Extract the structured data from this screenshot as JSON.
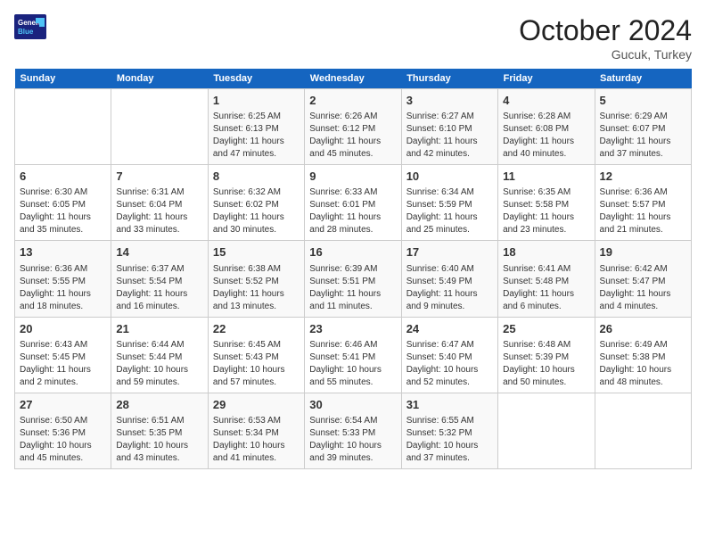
{
  "header": {
    "logo_general": "General",
    "logo_blue": "Blue",
    "month_title": "October 2024",
    "location": "Gucuk, Turkey"
  },
  "weekdays": [
    "Sunday",
    "Monday",
    "Tuesday",
    "Wednesday",
    "Thursday",
    "Friday",
    "Saturday"
  ],
  "weeks": [
    [
      {
        "day": "",
        "info": ""
      },
      {
        "day": "",
        "info": ""
      },
      {
        "day": "1",
        "info": "Sunrise: 6:25 AM\nSunset: 6:13 PM\nDaylight: 11 hours and 47 minutes."
      },
      {
        "day": "2",
        "info": "Sunrise: 6:26 AM\nSunset: 6:12 PM\nDaylight: 11 hours and 45 minutes."
      },
      {
        "day": "3",
        "info": "Sunrise: 6:27 AM\nSunset: 6:10 PM\nDaylight: 11 hours and 42 minutes."
      },
      {
        "day": "4",
        "info": "Sunrise: 6:28 AM\nSunset: 6:08 PM\nDaylight: 11 hours and 40 minutes."
      },
      {
        "day": "5",
        "info": "Sunrise: 6:29 AM\nSunset: 6:07 PM\nDaylight: 11 hours and 37 minutes."
      }
    ],
    [
      {
        "day": "6",
        "info": "Sunrise: 6:30 AM\nSunset: 6:05 PM\nDaylight: 11 hours and 35 minutes."
      },
      {
        "day": "7",
        "info": "Sunrise: 6:31 AM\nSunset: 6:04 PM\nDaylight: 11 hours and 33 minutes."
      },
      {
        "day": "8",
        "info": "Sunrise: 6:32 AM\nSunset: 6:02 PM\nDaylight: 11 hours and 30 minutes."
      },
      {
        "day": "9",
        "info": "Sunrise: 6:33 AM\nSunset: 6:01 PM\nDaylight: 11 hours and 28 minutes."
      },
      {
        "day": "10",
        "info": "Sunrise: 6:34 AM\nSunset: 5:59 PM\nDaylight: 11 hours and 25 minutes."
      },
      {
        "day": "11",
        "info": "Sunrise: 6:35 AM\nSunset: 5:58 PM\nDaylight: 11 hours and 23 minutes."
      },
      {
        "day": "12",
        "info": "Sunrise: 6:36 AM\nSunset: 5:57 PM\nDaylight: 11 hours and 21 minutes."
      }
    ],
    [
      {
        "day": "13",
        "info": "Sunrise: 6:36 AM\nSunset: 5:55 PM\nDaylight: 11 hours and 18 minutes."
      },
      {
        "day": "14",
        "info": "Sunrise: 6:37 AM\nSunset: 5:54 PM\nDaylight: 11 hours and 16 minutes."
      },
      {
        "day": "15",
        "info": "Sunrise: 6:38 AM\nSunset: 5:52 PM\nDaylight: 11 hours and 13 minutes."
      },
      {
        "day": "16",
        "info": "Sunrise: 6:39 AM\nSunset: 5:51 PM\nDaylight: 11 hours and 11 minutes."
      },
      {
        "day": "17",
        "info": "Sunrise: 6:40 AM\nSunset: 5:49 PM\nDaylight: 11 hours and 9 minutes."
      },
      {
        "day": "18",
        "info": "Sunrise: 6:41 AM\nSunset: 5:48 PM\nDaylight: 11 hours and 6 minutes."
      },
      {
        "day": "19",
        "info": "Sunrise: 6:42 AM\nSunset: 5:47 PM\nDaylight: 11 hours and 4 minutes."
      }
    ],
    [
      {
        "day": "20",
        "info": "Sunrise: 6:43 AM\nSunset: 5:45 PM\nDaylight: 11 hours and 2 minutes."
      },
      {
        "day": "21",
        "info": "Sunrise: 6:44 AM\nSunset: 5:44 PM\nDaylight: 10 hours and 59 minutes."
      },
      {
        "day": "22",
        "info": "Sunrise: 6:45 AM\nSunset: 5:43 PM\nDaylight: 10 hours and 57 minutes."
      },
      {
        "day": "23",
        "info": "Sunrise: 6:46 AM\nSunset: 5:41 PM\nDaylight: 10 hours and 55 minutes."
      },
      {
        "day": "24",
        "info": "Sunrise: 6:47 AM\nSunset: 5:40 PM\nDaylight: 10 hours and 52 minutes."
      },
      {
        "day": "25",
        "info": "Sunrise: 6:48 AM\nSunset: 5:39 PM\nDaylight: 10 hours and 50 minutes."
      },
      {
        "day": "26",
        "info": "Sunrise: 6:49 AM\nSunset: 5:38 PM\nDaylight: 10 hours and 48 minutes."
      }
    ],
    [
      {
        "day": "27",
        "info": "Sunrise: 6:50 AM\nSunset: 5:36 PM\nDaylight: 10 hours and 45 minutes."
      },
      {
        "day": "28",
        "info": "Sunrise: 6:51 AM\nSunset: 5:35 PM\nDaylight: 10 hours and 43 minutes."
      },
      {
        "day": "29",
        "info": "Sunrise: 6:53 AM\nSunset: 5:34 PM\nDaylight: 10 hours and 41 minutes."
      },
      {
        "day": "30",
        "info": "Sunrise: 6:54 AM\nSunset: 5:33 PM\nDaylight: 10 hours and 39 minutes."
      },
      {
        "day": "31",
        "info": "Sunrise: 6:55 AM\nSunset: 5:32 PM\nDaylight: 10 hours and 37 minutes."
      },
      {
        "day": "",
        "info": ""
      },
      {
        "day": "",
        "info": ""
      }
    ]
  ]
}
